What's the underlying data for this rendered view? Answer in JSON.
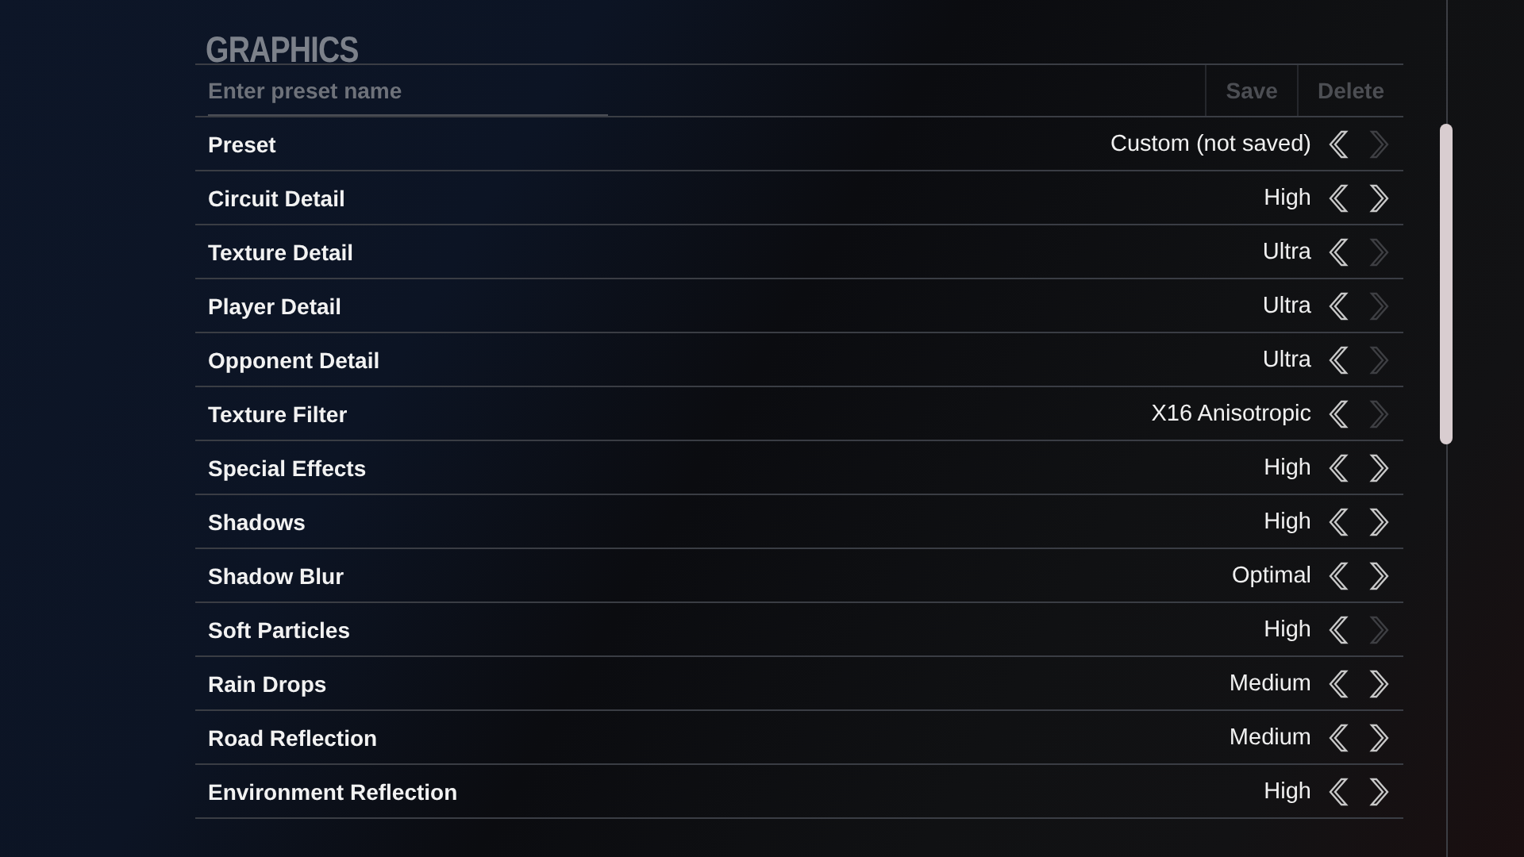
{
  "title": "GRAPHICS",
  "preset_field": {
    "placeholder": "Enter preset name"
  },
  "buttons": [
    {
      "label": "Save",
      "disabled": true
    },
    {
      "label": "Delete",
      "disabled": true
    }
  ],
  "settings": [
    {
      "label": "Preset",
      "value": "Custom (not saved)",
      "prev_enabled": true,
      "next_enabled": false
    },
    {
      "label": "Circuit Detail",
      "value": "High",
      "prev_enabled": true,
      "next_enabled": true
    },
    {
      "label": "Texture Detail",
      "value": "Ultra",
      "prev_enabled": true,
      "next_enabled": false
    },
    {
      "label": "Player Detail",
      "value": "Ultra",
      "prev_enabled": true,
      "next_enabled": false
    },
    {
      "label": "Opponent Detail",
      "value": "Ultra",
      "prev_enabled": true,
      "next_enabled": false
    },
    {
      "label": "Texture Filter",
      "value": "X16 Anisotropic",
      "prev_enabled": true,
      "next_enabled": false
    },
    {
      "label": "Special Effects",
      "value": "High",
      "prev_enabled": true,
      "next_enabled": true
    },
    {
      "label": "Shadows",
      "value": "High",
      "prev_enabled": true,
      "next_enabled": true
    },
    {
      "label": "Shadow Blur",
      "value": "Optimal",
      "prev_enabled": true,
      "next_enabled": true
    },
    {
      "label": "Soft Particles",
      "value": "High",
      "prev_enabled": true,
      "next_enabled": false
    },
    {
      "label": "Rain Drops",
      "value": "Medium",
      "prev_enabled": true,
      "next_enabled": true
    },
    {
      "label": "Road Reflection",
      "value": "Medium",
      "prev_enabled": true,
      "next_enabled": true
    },
    {
      "label": "Environment Reflection",
      "value": "High",
      "prev_enabled": true,
      "next_enabled": true
    }
  ]
}
